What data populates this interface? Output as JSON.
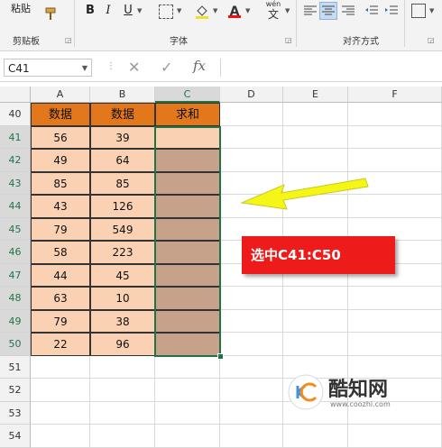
{
  "ribbon": {
    "paste_label": "粘贴",
    "clipboard_label": "剪贴板",
    "font_label": "字体",
    "align_label": "对齐方式",
    "bold": "B",
    "italic": "I",
    "underline": "U",
    "wen": "wén",
    "wen_char": "文"
  },
  "formula_bar": {
    "name_box": "C41",
    "fx": "fx",
    "cancel": "✕",
    "confirm": "✓",
    "formula": ""
  },
  "columns": [
    "A",
    "B",
    "C",
    "D",
    "E",
    "F"
  ],
  "rows": [
    "40",
    "41",
    "42",
    "43",
    "44",
    "45",
    "46",
    "47",
    "48",
    "49",
    "50",
    "51",
    "52",
    "53",
    "54"
  ],
  "table": {
    "headers": [
      "数据",
      "数据",
      "求和"
    ],
    "col_a": [
      "56",
      "49",
      "85",
      "43",
      "79",
      "58",
      "44",
      "63",
      "79",
      "22"
    ],
    "col_b": [
      "39",
      "64",
      "85",
      "126",
      "549",
      "223",
      "45",
      "10",
      "38",
      "96"
    ]
  },
  "annotation": {
    "callout_text": "选中C41:C50",
    "arrow_color": "#f5f516"
  },
  "watermark": {
    "title": "酷知网",
    "url": "www.coozhi.com"
  },
  "colors": {
    "header_orange": "#e2781b",
    "data_peach": "#fbd1b3",
    "selected_fill": "#c6a28b",
    "excel_green": "#217346",
    "callout_red": "#ee1b1b"
  }
}
